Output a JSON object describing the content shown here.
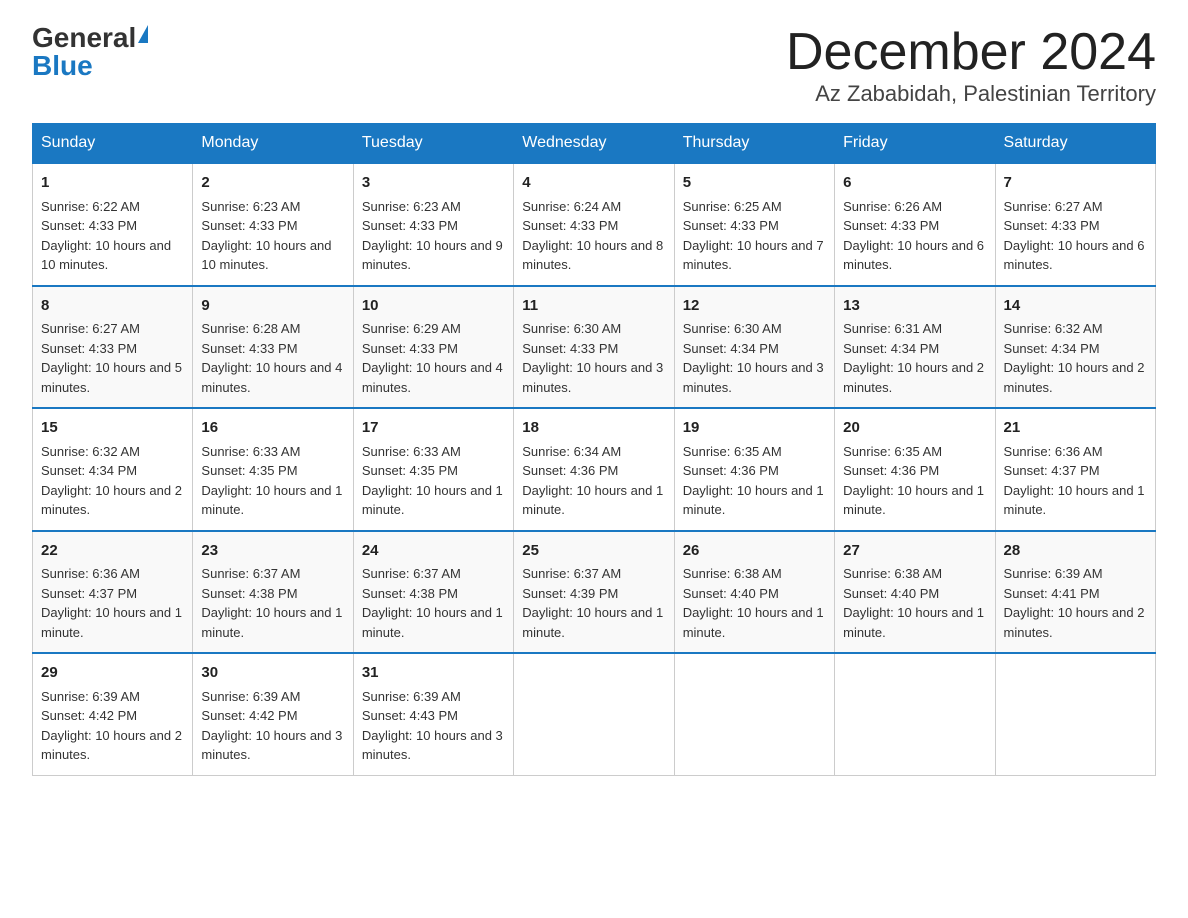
{
  "logo": {
    "general": "General",
    "blue": "Blue"
  },
  "title": {
    "month_year": "December 2024",
    "location": "Az Zababidah, Palestinian Territory"
  },
  "days_of_week": [
    "Sunday",
    "Monday",
    "Tuesday",
    "Wednesday",
    "Thursday",
    "Friday",
    "Saturday"
  ],
  "weeks": [
    [
      {
        "day": "1",
        "sunrise": "6:22 AM",
        "sunset": "4:33 PM",
        "daylight": "10 hours and 10 minutes."
      },
      {
        "day": "2",
        "sunrise": "6:23 AM",
        "sunset": "4:33 PM",
        "daylight": "10 hours and 10 minutes."
      },
      {
        "day": "3",
        "sunrise": "6:23 AM",
        "sunset": "4:33 PM",
        "daylight": "10 hours and 9 minutes."
      },
      {
        "day": "4",
        "sunrise": "6:24 AM",
        "sunset": "4:33 PM",
        "daylight": "10 hours and 8 minutes."
      },
      {
        "day": "5",
        "sunrise": "6:25 AM",
        "sunset": "4:33 PM",
        "daylight": "10 hours and 7 minutes."
      },
      {
        "day": "6",
        "sunrise": "6:26 AM",
        "sunset": "4:33 PM",
        "daylight": "10 hours and 6 minutes."
      },
      {
        "day": "7",
        "sunrise": "6:27 AM",
        "sunset": "4:33 PM",
        "daylight": "10 hours and 6 minutes."
      }
    ],
    [
      {
        "day": "8",
        "sunrise": "6:27 AM",
        "sunset": "4:33 PM",
        "daylight": "10 hours and 5 minutes."
      },
      {
        "day": "9",
        "sunrise": "6:28 AM",
        "sunset": "4:33 PM",
        "daylight": "10 hours and 4 minutes."
      },
      {
        "day": "10",
        "sunrise": "6:29 AM",
        "sunset": "4:33 PM",
        "daylight": "10 hours and 4 minutes."
      },
      {
        "day": "11",
        "sunrise": "6:30 AM",
        "sunset": "4:33 PM",
        "daylight": "10 hours and 3 minutes."
      },
      {
        "day": "12",
        "sunrise": "6:30 AM",
        "sunset": "4:34 PM",
        "daylight": "10 hours and 3 minutes."
      },
      {
        "day": "13",
        "sunrise": "6:31 AM",
        "sunset": "4:34 PM",
        "daylight": "10 hours and 2 minutes."
      },
      {
        "day": "14",
        "sunrise": "6:32 AM",
        "sunset": "4:34 PM",
        "daylight": "10 hours and 2 minutes."
      }
    ],
    [
      {
        "day": "15",
        "sunrise": "6:32 AM",
        "sunset": "4:34 PM",
        "daylight": "10 hours and 2 minutes."
      },
      {
        "day": "16",
        "sunrise": "6:33 AM",
        "sunset": "4:35 PM",
        "daylight": "10 hours and 1 minute."
      },
      {
        "day": "17",
        "sunrise": "6:33 AM",
        "sunset": "4:35 PM",
        "daylight": "10 hours and 1 minute."
      },
      {
        "day": "18",
        "sunrise": "6:34 AM",
        "sunset": "4:36 PM",
        "daylight": "10 hours and 1 minute."
      },
      {
        "day": "19",
        "sunrise": "6:35 AM",
        "sunset": "4:36 PM",
        "daylight": "10 hours and 1 minute."
      },
      {
        "day": "20",
        "sunrise": "6:35 AM",
        "sunset": "4:36 PM",
        "daylight": "10 hours and 1 minute."
      },
      {
        "day": "21",
        "sunrise": "6:36 AM",
        "sunset": "4:37 PM",
        "daylight": "10 hours and 1 minute."
      }
    ],
    [
      {
        "day": "22",
        "sunrise": "6:36 AM",
        "sunset": "4:37 PM",
        "daylight": "10 hours and 1 minute."
      },
      {
        "day": "23",
        "sunrise": "6:37 AM",
        "sunset": "4:38 PM",
        "daylight": "10 hours and 1 minute."
      },
      {
        "day": "24",
        "sunrise": "6:37 AM",
        "sunset": "4:38 PM",
        "daylight": "10 hours and 1 minute."
      },
      {
        "day": "25",
        "sunrise": "6:37 AM",
        "sunset": "4:39 PM",
        "daylight": "10 hours and 1 minute."
      },
      {
        "day": "26",
        "sunrise": "6:38 AM",
        "sunset": "4:40 PM",
        "daylight": "10 hours and 1 minute."
      },
      {
        "day": "27",
        "sunrise": "6:38 AM",
        "sunset": "4:40 PM",
        "daylight": "10 hours and 1 minute."
      },
      {
        "day": "28",
        "sunrise": "6:39 AM",
        "sunset": "4:41 PM",
        "daylight": "10 hours and 2 minutes."
      }
    ],
    [
      {
        "day": "29",
        "sunrise": "6:39 AM",
        "sunset": "4:42 PM",
        "daylight": "10 hours and 2 minutes."
      },
      {
        "day": "30",
        "sunrise": "6:39 AM",
        "sunset": "4:42 PM",
        "daylight": "10 hours and 3 minutes."
      },
      {
        "day": "31",
        "sunrise": "6:39 AM",
        "sunset": "4:43 PM",
        "daylight": "10 hours and 3 minutes."
      },
      null,
      null,
      null,
      null
    ]
  ],
  "labels": {
    "sunrise_prefix": "Sunrise: ",
    "sunset_prefix": "Sunset: ",
    "daylight_prefix": "Daylight: "
  }
}
